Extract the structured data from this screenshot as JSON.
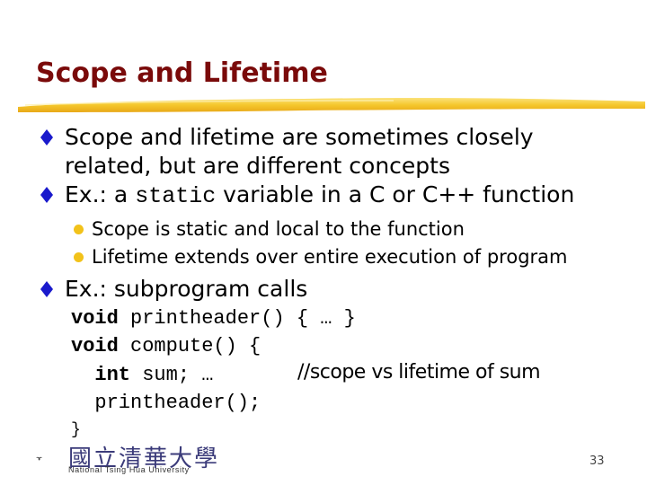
{
  "slide": {
    "title": "Scope and Lifetime",
    "bullets": [
      {
        "lines": [
          "Scope and lifetime are sometimes closely",
          "related, but are different concepts"
        ]
      },
      {
        "prefix": "Ex.: a ",
        "code": "static",
        "suffix": " variable in a C or C++ function",
        "sub_bullets": [
          "Scope is static and local to the function",
          "Lifetime extends over entire execution of program"
        ]
      },
      {
        "text": "Ex.: subprogram calls"
      }
    ],
    "code": {
      "line1": {
        "kw": "void",
        "rest": " printheader() { … }"
      },
      "line2": {
        "kw": "void",
        "rest": " compute() {"
      },
      "line3": {
        "kw": "  int",
        "rest": " sum; …"
      },
      "line3_comment": "//scope vs lifetime of sum",
      "line4": "  printheader();",
      "line5": "}"
    },
    "footer": {
      "logo_chinese": "國立清華大學",
      "logo_english": "National Tsing Hua University",
      "page_number": "33"
    },
    "colors": {
      "title": "#7a0a0a",
      "bullet_diamond": "#1a1acc",
      "sub_bullet": "#f2c21a",
      "underline": "#f5c72c"
    }
  }
}
